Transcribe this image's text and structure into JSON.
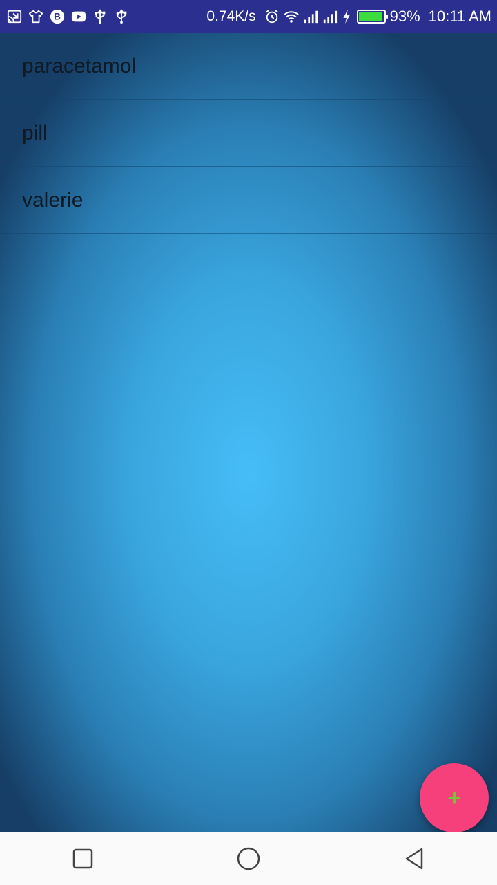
{
  "status_bar": {
    "net_speed": "0.74K/s",
    "battery_percent": "93%",
    "battery_level": 0.93,
    "time": "10:11 AM",
    "left_icons": [
      "cast-icon",
      "tshirt-icon",
      "b-icon",
      "youtube-icon",
      "usb-icon",
      "usb-icon"
    ],
    "right_icons": [
      "alarm-icon",
      "wifi-icon",
      "signal-icon",
      "signal-icon",
      "charging-icon"
    ]
  },
  "list": {
    "items": [
      {
        "label": "paracetamol"
      },
      {
        "label": "pill"
      },
      {
        "label": "valerie"
      }
    ]
  },
  "fab": {
    "label": "+",
    "icon": "plus-icon",
    "background": "#f5407c"
  },
  "nav": {
    "buttons": [
      "recent-apps-icon",
      "home-icon",
      "back-icon"
    ]
  },
  "colors": {
    "status_bar": "#2b2f8f",
    "background_center": "#46bdf7",
    "background_edge": "#163e66"
  }
}
